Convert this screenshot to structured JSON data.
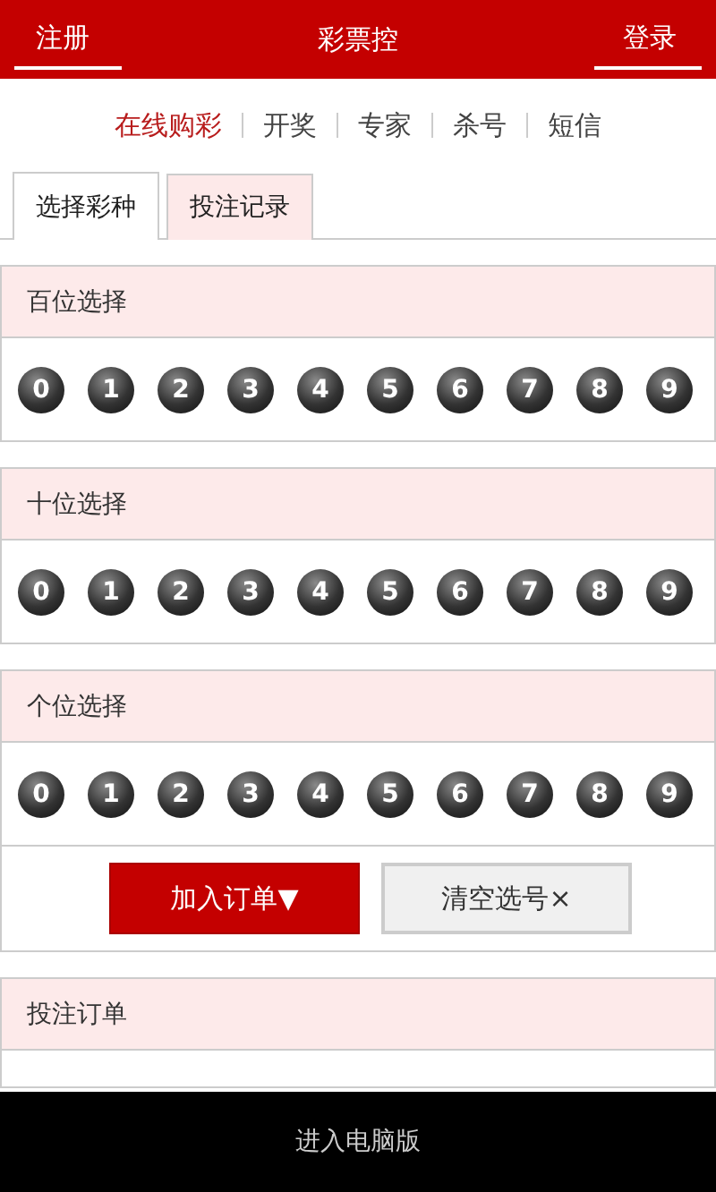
{
  "header": {
    "left_link": "注册",
    "title": "彩票控",
    "right_link": "登录"
  },
  "nav": [
    {
      "label": "在线购彩",
      "selected": true
    },
    {
      "label": "开奖",
      "selected": false
    },
    {
      "label": "专家",
      "selected": false
    },
    {
      "label": "杀号",
      "selected": false
    },
    {
      "label": "短信",
      "selected": false
    }
  ],
  "tabs": [
    {
      "label": "选择彩种",
      "selected": true
    },
    {
      "label": "投注记录",
      "selected": false
    }
  ],
  "sections": [
    {
      "title": "百位选择",
      "numbers": [
        "0",
        "1",
        "2",
        "3",
        "4",
        "5",
        "6",
        "7",
        "8",
        "9"
      ]
    },
    {
      "title": "十位选择",
      "numbers": [
        "0",
        "1",
        "2",
        "3",
        "4",
        "5",
        "6",
        "7",
        "8",
        "9"
      ]
    },
    {
      "title": "个位选择",
      "numbers": [
        "0",
        "1",
        "2",
        "3",
        "4",
        "5",
        "6",
        "7",
        "8",
        "9"
      ]
    }
  ],
  "buttons": [
    {
      "kind": "primary",
      "label": "加入订单▼"
    },
    {
      "kind": "secondary",
      "label": "清空选号×"
    }
  ],
  "order": {
    "title": "投注订单"
  },
  "footer": "进入电脑版"
}
